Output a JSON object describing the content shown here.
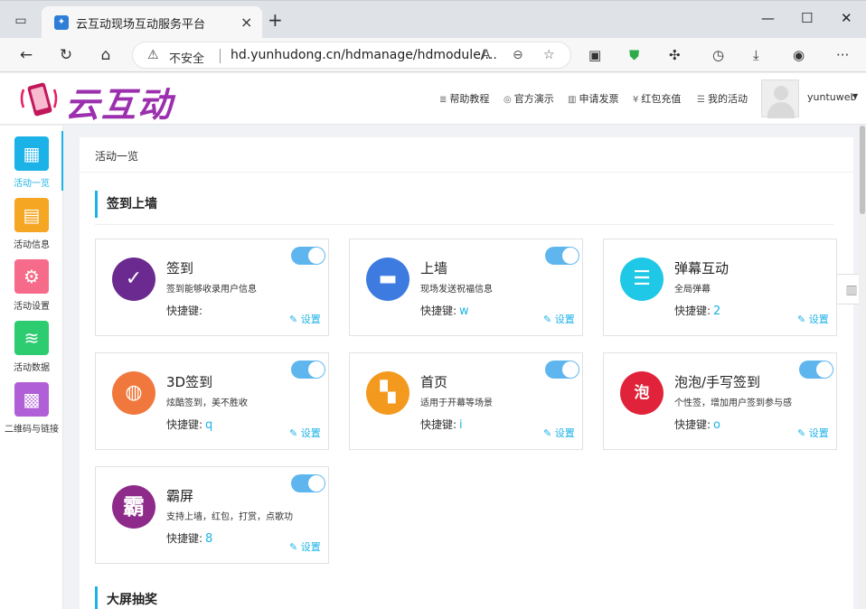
{
  "browser": {
    "tab_title": "云互动现场互动服务平台",
    "tab_close": "×",
    "new_tab": "+",
    "insecure": "不安全",
    "url": "hd.yunhudong.cn/hdmanage/hdmodule/..."
  },
  "header": {
    "logo_text": "云互动",
    "nav": [
      "帮助教程",
      "官方演示",
      "申请发票",
      "红包充值",
      "我的活动"
    ],
    "username": "yuntuweb"
  },
  "sidebar": {
    "items": [
      {
        "label": "活动一览",
        "color": "#1bb2e8"
      },
      {
        "label": "活动信息",
        "color": "#f5a623"
      },
      {
        "label": "活动设置",
        "color": "#f76b8a"
      },
      {
        "label": "活动数据",
        "color": "#2ecc71"
      },
      {
        "label": "二维码与链接",
        "color": "#b05fd6"
      }
    ]
  },
  "main": {
    "breadcrumb": "活动一览",
    "section1": "签到上墙",
    "section2": "大屏抽奖",
    "key_label": "快捷键:",
    "setting_label": "设置",
    "cards": [
      {
        "title": "签到",
        "desc": "签到能够收录用户信息",
        "key": "",
        "color": "#6a2a8f"
      },
      {
        "title": "上墙",
        "desc": "现场发送祝福信息",
        "key": "w",
        "color": "#3d7be0"
      },
      {
        "title": "弹幕互动",
        "desc": "全局弹幕",
        "key": "2",
        "color": "#1ec8e6"
      },
      {
        "title": "3D签到",
        "desc": "炫酷签到，美不胜收",
        "key": "q",
        "color": "#f0783c"
      },
      {
        "title": "首页",
        "desc": "适用于开幕等场景",
        "key": "i",
        "color": "#f39a1e"
      },
      {
        "title": "泡泡/手写签到",
        "desc": "个性签，增加用户签到参与感",
        "key": "o",
        "color": "#e0233a"
      },
      {
        "title": "霸屏",
        "desc": "支持上墙，红包，打赏，点歌功",
        "key": "8",
        "color": "#8e2a8a"
      }
    ]
  }
}
